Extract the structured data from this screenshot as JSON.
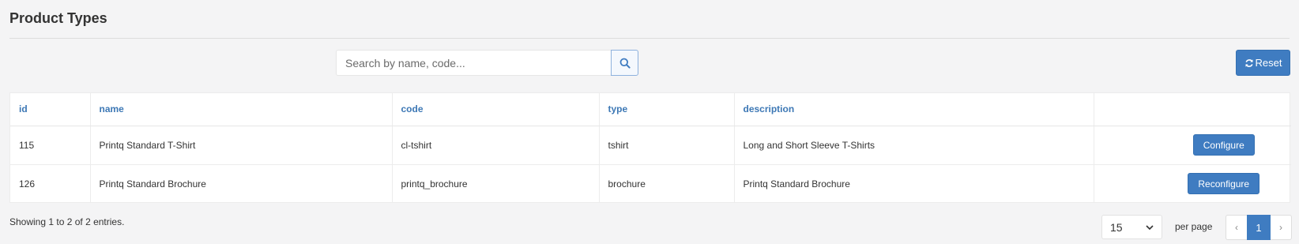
{
  "page": {
    "title": "Product Types"
  },
  "search": {
    "placeholder": "Search by name, code...",
    "value": "",
    "icon": "search-icon"
  },
  "toolbar": {
    "reset_label": "Reset",
    "reset_icon": "refresh-icon"
  },
  "table": {
    "columns": [
      "id",
      "name",
      "code",
      "type",
      "description",
      ""
    ],
    "rows": [
      {
        "id": "115",
        "name": "Printq Standard T-Shirt",
        "code": "cl-tshirt",
        "type": "tshirt",
        "description": "Long and Short Sleeve T-Shirts",
        "action": "Configure"
      },
      {
        "id": "126",
        "name": "Printq Standard Brochure",
        "code": "printq_brochure",
        "type": "brochure",
        "description": "Printq Standard Brochure",
        "action": "Reconfigure"
      }
    ]
  },
  "footer": {
    "summary": "Showing 1 to 2 of 2 entries.",
    "per_page_value": "15",
    "per_page_label": "per page",
    "pagination": {
      "prev": "‹",
      "current": "1",
      "next": "›"
    }
  },
  "colors": {
    "accent": "#3f7cc1",
    "header_text": "#3d78b5",
    "background": "#f4f4f5"
  }
}
